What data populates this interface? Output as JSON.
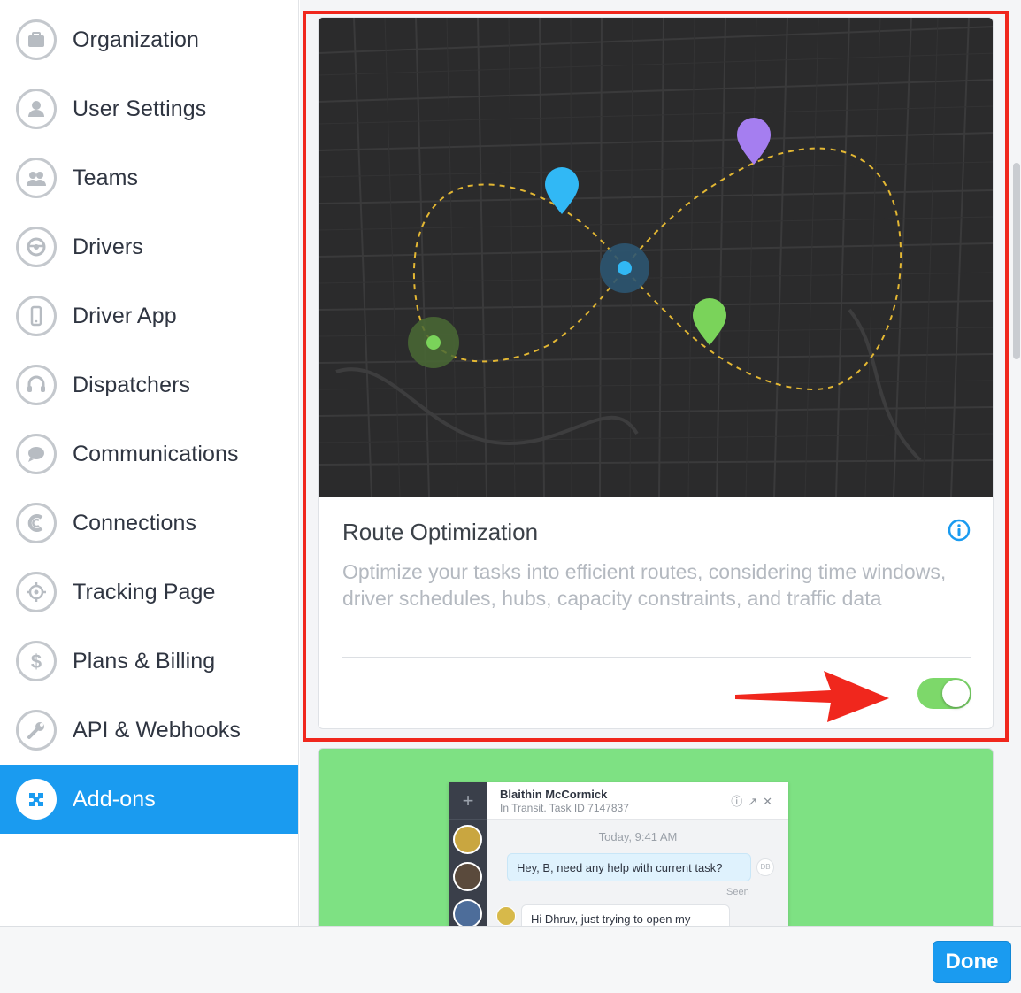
{
  "sidebar": {
    "items": [
      {
        "label": "Organization",
        "icon": "briefcase-icon"
      },
      {
        "label": "User Settings",
        "icon": "user-icon"
      },
      {
        "label": "Teams",
        "icon": "team-icon"
      },
      {
        "label": "Drivers",
        "icon": "steering-wheel-icon"
      },
      {
        "label": "Driver App",
        "icon": "phone-icon"
      },
      {
        "label": "Dispatchers",
        "icon": "headset-icon"
      },
      {
        "label": "Communications",
        "icon": "chat-bubble-icon"
      },
      {
        "label": "Connections",
        "icon": "connections-icon"
      },
      {
        "label": "Tracking Page",
        "icon": "crosshair-icon"
      },
      {
        "label": "Plans & Billing",
        "icon": "dollar-icon"
      },
      {
        "label": "API & Webhooks",
        "icon": "wrench-icon"
      },
      {
        "label": "Add-ons",
        "icon": "puzzle-icon",
        "active": true
      }
    ]
  },
  "addon_card": {
    "title": "Route Optimization",
    "description": "Optimize your tasks into efficient routes, considering time windows, driver schedules, hubs, capacity constraints, and traffic data",
    "enabled": true,
    "toggle_color": "#7dd86a",
    "pin_colors": {
      "blue": "#31b8f5",
      "purple": "#a57ef0",
      "green": "#7ad35a"
    }
  },
  "chat_preview": {
    "name": "Blaithin McCormick",
    "subtitle": "In Transit. Task ID 7147837",
    "time": "Today, 9:41 AM",
    "outgoing": "Hey, B, need any help with current task?",
    "badge": "DB",
    "seen": "Seen",
    "incoming": "Hi Dhruv, just trying to open my trunk."
  },
  "footer": {
    "done_label": "Done"
  },
  "colors": {
    "accent": "#1a9bf0",
    "highlight": "#f0271d",
    "card_bg_green": "#7ee183"
  }
}
